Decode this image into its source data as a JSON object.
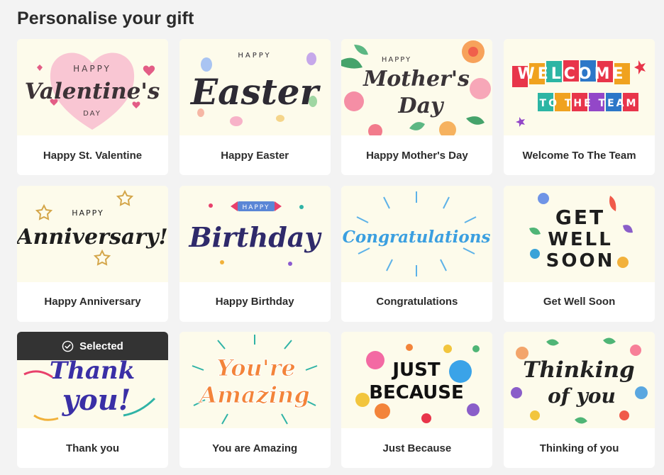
{
  "page": {
    "title": "Personalise your gift"
  },
  "selected_badge": {
    "label": "Selected",
    "icon": "check-circle-icon"
  },
  "cards": [
    {
      "label": "Happy St. Valentine",
      "art": {
        "top": "HAPPY",
        "main": "Valentine's",
        "bottom": "DAY"
      }
    },
    {
      "label": "Happy Easter",
      "art": {
        "top": "HAPPY",
        "main": "Easter"
      }
    },
    {
      "label": "Happy Mother's Day",
      "art": {
        "top": "HAPPY",
        "main": "Mother's",
        "bottom": "Day"
      }
    },
    {
      "label": "Welcome To The Team",
      "art": {
        "main": "WELCOME",
        "bottom": "TO THE TEAM"
      }
    },
    {
      "label": "Happy Anniversary",
      "art": {
        "top": "HAPPY",
        "main": "Anniversary!"
      }
    },
    {
      "label": "Happy Birthday",
      "art": {
        "top": "HAPPY",
        "main": "Birthday"
      }
    },
    {
      "label": "Congratulations",
      "art": {
        "main": "Congratulations"
      }
    },
    {
      "label": "Get Well Soon",
      "art": {
        "line1": "GET",
        "line2": "WELL",
        "line3": "SOON"
      }
    },
    {
      "label": "Thank you",
      "selected": true,
      "art": {
        "main": "Thank",
        "bottom": "you!"
      }
    },
    {
      "label": "You are Amazing",
      "art": {
        "main": "You're",
        "bottom": "Amazing"
      }
    },
    {
      "label": "Just Because",
      "art": {
        "main": "JUST",
        "bottom": "BECAUSE"
      }
    },
    {
      "label": "Thinking of you",
      "art": {
        "main": "Thinking",
        "bottom": "of you"
      }
    }
  ],
  "colors": {
    "background": "#f3f3f3",
    "card": "#ffffff",
    "art_bg": "#fdfbeb",
    "selected_banner": "#333333"
  }
}
